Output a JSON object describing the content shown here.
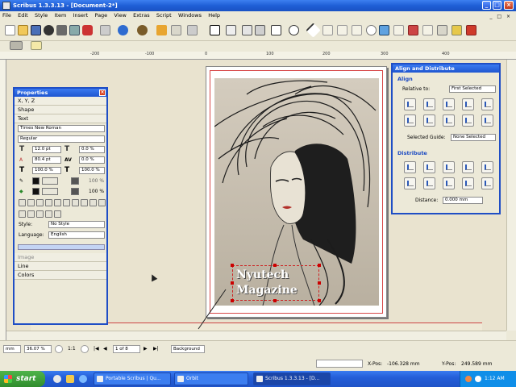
{
  "window": {
    "title": "Scribus 1.3.3.13 - [Document-2*]"
  },
  "menu": [
    "File",
    "Edit",
    "Style",
    "Item",
    "Insert",
    "Page",
    "View",
    "Extras",
    "Script",
    "Windows",
    "Help"
  ],
  "ruler": {
    "h_ticks": [
      "-200",
      "-100",
      "0",
      "100",
      "200",
      "300",
      "400"
    ]
  },
  "canvas": {
    "cover_text_line1": "Nyutech",
    "cover_text_line2": "Magazine"
  },
  "properties": {
    "title": "Properties",
    "sections": {
      "xyz": "X, Y, Z",
      "shape": "Shape",
      "text": "Text",
      "image": "Image",
      "line": "Line",
      "colors": "Colors"
    },
    "font_family": "Times New Roman",
    "font_style": "Regular",
    "font_size": "12.0 pt",
    "tracking_pct": "0.0 %",
    "line_spacing": "80.4 pt",
    "kerning": "0.0 %",
    "scale_width": "100.0 %",
    "scale_height": "100.0 %",
    "stroke_shade": "100 %",
    "fill_shade": "100 %",
    "style_label": "Style:",
    "style_value": "No Style",
    "language_label": "Language:",
    "language_value": "English"
  },
  "align": {
    "title": "Align and Distribute",
    "align_group": "Align",
    "relative_to_label": "Relative to:",
    "relative_to_value": "First Selected",
    "selected_guide_label": "Selected Guide:",
    "selected_guide_value": "None Selected",
    "distribute_group": "Distribute",
    "distance_label": "Distance:",
    "distance_value": "0.000 mm"
  },
  "status": {
    "unit": "mm",
    "zoom": "36.07 %",
    "ratio": "1:1",
    "page": "1 of 8",
    "layer": "Background",
    "xpos_label": "X-Pos:",
    "xpos_value": "-106.328 mm",
    "ypos_label": "Y-Pos:",
    "ypos_value": "249.589 mm"
  },
  "taskbar": {
    "start": "start",
    "tasks": [
      "Portable Scribus | Qu...",
      "Orbit",
      "Scribus 1.3.3.13 - [D..."
    ],
    "clock": "1:12 AM"
  }
}
